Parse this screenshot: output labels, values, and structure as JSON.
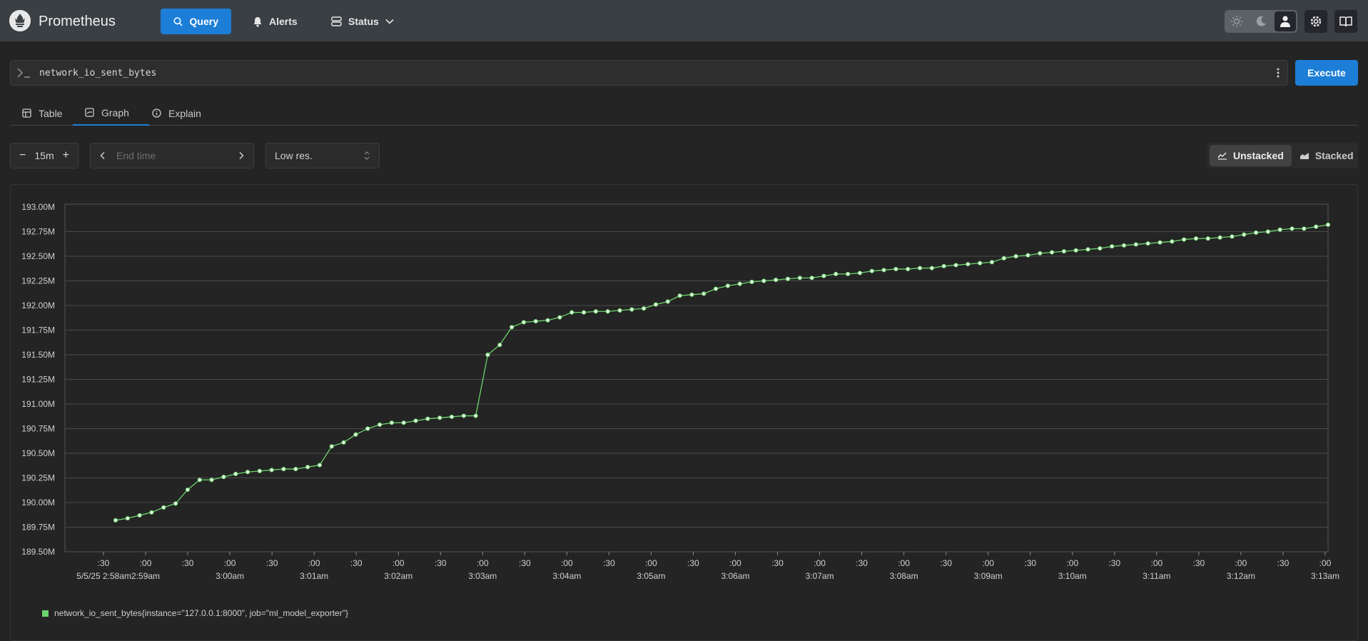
{
  "app": {
    "title": "Prometheus"
  },
  "nav": {
    "items": [
      {
        "label": "Query",
        "icon": "search-icon"
      },
      {
        "label": "Alerts",
        "icon": "bell-icon"
      },
      {
        "label": "Status",
        "icon": "server-icon"
      }
    ]
  },
  "theme": {
    "options": [
      "light",
      "dark",
      "auto"
    ],
    "selected": "auto"
  },
  "query": {
    "expression": "network_io_sent_bytes",
    "execute_label": "Execute"
  },
  "tabs": [
    {
      "label": "Table",
      "icon": "table-icon"
    },
    {
      "label": "Graph",
      "icon": "graph-icon",
      "active": true
    },
    {
      "label": "Explain",
      "icon": "info-icon"
    }
  ],
  "controls": {
    "range": "15m",
    "end_time_placeholder": "End time",
    "resolution": "Low res.",
    "stacking_options": [
      "Unstacked",
      "Stacked"
    ],
    "stacking_selected": "Unstacked"
  },
  "colors": {
    "accent": "#1c7ed6",
    "series": "#6bd36b"
  },
  "chart_data": {
    "type": "line",
    "ylim": [
      189.5,
      193.0
    ],
    "yunit": "M",
    "ytick_labels": [
      "193.00M",
      "192.75M",
      "192.50M",
      "192.25M",
      "192.00M",
      "191.75M",
      "191.50M",
      "191.25M",
      "191.00M",
      "190.75M",
      "190.50M",
      "190.25M",
      "190.00M",
      "189.75M",
      "189.50M"
    ],
    "xtick_labels": [
      {
        "top": ":30",
        "bottom": "5/5/25 2:58am"
      },
      {
        "top": ":00",
        "bottom": "2:59am"
      },
      {
        "top": ":30",
        "bottom": ""
      },
      {
        "top": ":00",
        "bottom": "3:00am"
      },
      {
        "top": ":30",
        "bottom": ""
      },
      {
        "top": ":00",
        "bottom": "3:01am"
      },
      {
        "top": ":30",
        "bottom": ""
      },
      {
        "top": ":00",
        "bottom": "3:02am"
      },
      {
        "top": ":30",
        "bottom": ""
      },
      {
        "top": ":00",
        "bottom": "3:03am"
      },
      {
        "top": ":30",
        "bottom": ""
      },
      {
        "top": ":00",
        "bottom": "3:04am"
      },
      {
        "top": ":30",
        "bottom": ""
      },
      {
        "top": ":00",
        "bottom": "3:05am"
      },
      {
        "top": ":30",
        "bottom": ""
      },
      {
        "top": ":00",
        "bottom": "3:06am"
      },
      {
        "top": ":30",
        "bottom": ""
      },
      {
        "top": ":00",
        "bottom": "3:07am"
      },
      {
        "top": ":30",
        "bottom": ""
      },
      {
        "top": ":00",
        "bottom": "3:08am"
      },
      {
        "top": ":30",
        "bottom": ""
      },
      {
        "top": ":00",
        "bottom": "3:09am"
      },
      {
        "top": ":30",
        "bottom": ""
      },
      {
        "top": ":00",
        "bottom": "3:10am"
      },
      {
        "top": ":30",
        "bottom": ""
      },
      {
        "top": ":00",
        "bottom": "3:11am"
      },
      {
        "top": ":30",
        "bottom": ""
      },
      {
        "top": ":00",
        "bottom": "3:12am"
      },
      {
        "top": ":30",
        "bottom": ""
      },
      {
        "top": ":00",
        "bottom": "3:13am"
      }
    ],
    "series": [
      {
        "name": "network_io_sent_bytes{instance=\"127.0.0.1:8000\", job=\"ml_model_exporter\"}",
        "values": [
          189.82,
          189.84,
          189.87,
          189.9,
          189.95,
          189.99,
          190.13,
          190.23,
          190.23,
          190.26,
          190.29,
          190.31,
          190.32,
          190.33,
          190.34,
          190.34,
          190.36,
          190.38,
          190.57,
          190.61,
          190.69,
          190.75,
          190.79,
          190.81,
          190.81,
          190.83,
          190.85,
          190.86,
          190.87,
          190.88,
          190.88,
          191.5,
          191.6,
          191.78,
          191.83,
          191.84,
          191.85,
          191.88,
          191.93,
          191.93,
          191.94,
          191.94,
          191.95,
          191.96,
          191.97,
          192.01,
          192.04,
          192.1,
          192.11,
          192.12,
          192.17,
          192.2,
          192.22,
          192.24,
          192.25,
          192.26,
          192.27,
          192.28,
          192.28,
          192.3,
          192.32,
          192.32,
          192.33,
          192.35,
          192.36,
          192.37,
          192.37,
          192.38,
          192.38,
          192.4,
          192.41,
          192.42,
          192.43,
          192.44,
          192.48,
          192.5,
          192.51,
          192.53,
          192.54,
          192.55,
          192.56,
          192.57,
          192.58,
          192.6,
          192.61,
          192.62,
          192.63,
          192.64,
          192.65,
          192.67,
          192.68,
          192.68,
          192.69,
          192.7,
          192.72,
          192.74,
          192.75,
          192.77,
          192.78,
          192.78,
          192.8,
          192.82
        ]
      }
    ]
  }
}
